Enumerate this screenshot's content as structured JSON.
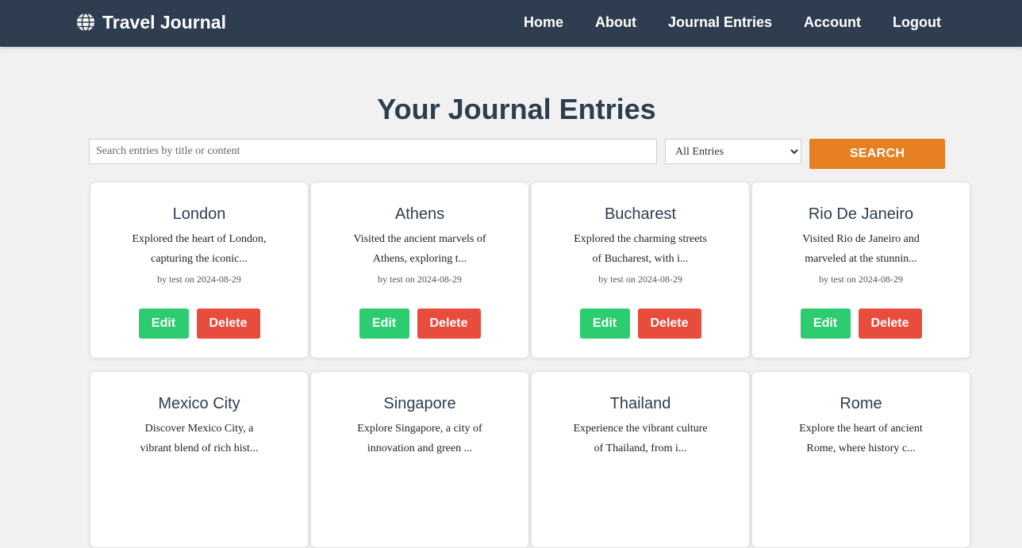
{
  "nav": {
    "brand": "Travel Journal",
    "brand_icon": "globe-icon",
    "links": [
      "Home",
      "About",
      "Journal Entries",
      "Account",
      "Logout"
    ]
  },
  "page": {
    "title": "Your Journal Entries"
  },
  "search": {
    "placeholder": "Search entries by title or content",
    "value": "",
    "filter_selected": "All Entries",
    "button_label": "SEARCH"
  },
  "colors": {
    "navbar": "#2e3d50",
    "search_button": "#e67e22",
    "edit_button": "#2ecc71",
    "delete_button": "#e74c3c"
  },
  "entries": [
    {
      "title": "London",
      "excerpt": "Explored the heart of London, capturing the iconic...",
      "meta": "by test on 2024-08-29",
      "edit_label": "Edit",
      "delete_label": "Delete"
    },
    {
      "title": "Athens",
      "excerpt": "Visited the ancient marvels of Athens, exploring t...",
      "meta": "by test on 2024-08-29",
      "edit_label": "Edit",
      "delete_label": "Delete"
    },
    {
      "title": "Bucharest",
      "excerpt": "Explored the charming streets of Bucharest, with i...",
      "meta": "by test on 2024-08-29",
      "edit_label": "Edit",
      "delete_label": "Delete"
    },
    {
      "title": "Rio De Janeiro",
      "excerpt": "Visited Rio de Janeiro and marveled at the stunnin...",
      "meta": "by test on 2024-08-29",
      "edit_label": "Edit",
      "delete_label": "Delete"
    },
    {
      "title": "Mexico City",
      "excerpt": "Discover Mexico City, a vibrant blend of rich hist...",
      "meta": "",
      "edit_label": "",
      "delete_label": ""
    },
    {
      "title": "Singapore",
      "excerpt": "Explore Singapore, a city of innovation and green ...",
      "meta": "",
      "edit_label": "",
      "delete_label": ""
    },
    {
      "title": "Thailand",
      "excerpt": "Experience the vibrant culture of Thailand, from i...",
      "meta": "",
      "edit_label": "",
      "delete_label": ""
    },
    {
      "title": "Rome",
      "excerpt": "Explore the heart of ancient Rome, where history c...",
      "meta": "",
      "edit_label": "",
      "delete_label": ""
    }
  ]
}
